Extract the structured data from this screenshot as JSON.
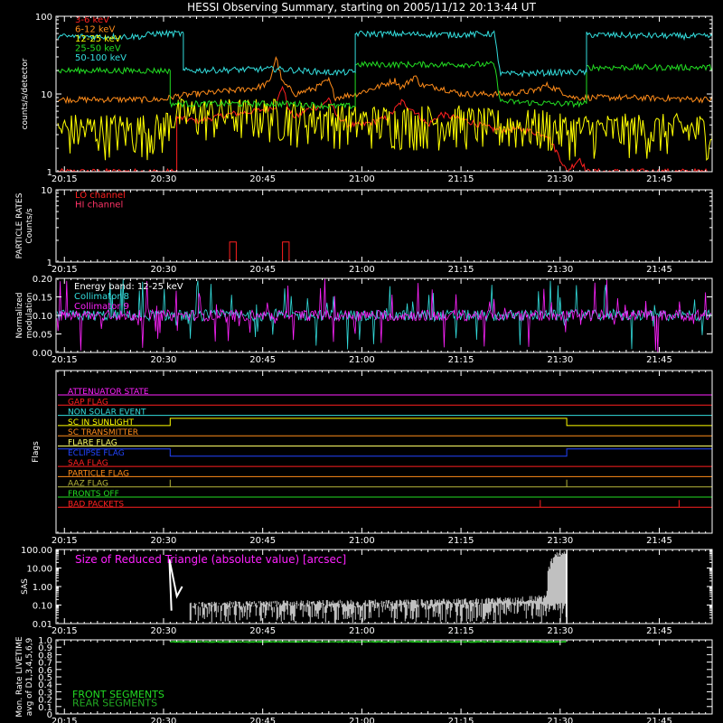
{
  "title": "HESSI Observing Summary, starting on 2005/11/12 20:13:44 UT",
  "time_axis": {
    "start": "20:13:44",
    "end": "21:53:00",
    "ticks": [
      "20:15",
      "20:30",
      "20:45",
      "21:00",
      "21:15",
      "21:30",
      "21:45"
    ]
  },
  "colors": {
    "red": "#ff2020",
    "orange": "#ff8c1a",
    "yellow": "#ffff00",
    "green": "#22dd22",
    "cyan": "#33dddd",
    "magenta": "#ff22ff",
    "blue": "#2244ff",
    "white": "#ffffff",
    "frame": "#ffffff"
  },
  "chart_data": [
    {
      "panel": "count-rates",
      "type": "line",
      "ylabel": "counts/s/detector",
      "yscale": "log",
      "ylim": [
        1,
        100
      ],
      "yticks": [
        "1",
        "10",
        "100"
      ],
      "series": [
        {
          "name": "3-6 keV",
          "color": "#ff2020",
          "points": [
            [
              "20:14",
              1.0
            ],
            [
              "20:32",
              1.0
            ],
            [
              "20:32",
              5.0
            ],
            [
              "20:35",
              4.5
            ],
            [
              "20:40",
              5.5
            ],
            [
              "20:44",
              6.0
            ],
            [
              "20:47",
              7.0
            ],
            [
              "20:48",
              13.0
            ],
            [
              "20:49",
              6.0
            ],
            [
              "20:50",
              5.0
            ],
            [
              "20:52",
              6.5
            ],
            [
              "20:54",
              7.0
            ],
            [
              "20:55",
              9.0
            ],
            [
              "20:56",
              5.5
            ],
            [
              "20:58",
              4.0
            ],
            [
              "21:00",
              4.0
            ],
            [
              "21:04",
              5.0
            ],
            [
              "21:06",
              8.0
            ],
            [
              "21:08",
              6.0
            ],
            [
              "21:10",
              4.0
            ],
            [
              "21:12",
              5.5
            ],
            [
              "21:16",
              4.5
            ],
            [
              "21:20",
              3.5
            ],
            [
              "21:24",
              3.5
            ],
            [
              "21:28",
              3.0
            ],
            [
              "21:30",
              1.5
            ],
            [
              "21:31",
              1.0
            ],
            [
              "21:33",
              1.5
            ],
            [
              "21:34",
              1.0
            ],
            [
              "21:53",
              1.0
            ]
          ]
        },
        {
          "name": "6-12 keV",
          "color": "#ff8c1a",
          "points": [
            [
              "20:14",
              8.5
            ],
            [
              "20:30",
              8.5
            ],
            [
              "20:32",
              9.5
            ],
            [
              "20:35",
              10.0
            ],
            [
              "20:40",
              11.0
            ],
            [
              "20:44",
              12.0
            ],
            [
              "20:46",
              14.0
            ],
            [
              "20:47",
              30.0
            ],
            [
              "20:48",
              14.0
            ],
            [
              "20:50",
              10.0
            ],
            [
              "20:53",
              12.0
            ],
            [
              "20:55",
              15.0
            ],
            [
              "20:56",
              9.0
            ],
            [
              "20:59",
              10.0
            ],
            [
              "21:02",
              12.0
            ],
            [
              "21:05",
              15.0
            ],
            [
              "21:06",
              12.0
            ],
            [
              "21:08",
              17.0
            ],
            [
              "21:09",
              13.0
            ],
            [
              "21:12",
              12.0
            ],
            [
              "21:15",
              10.0
            ],
            [
              "21:18",
              10.0
            ],
            [
              "21:22",
              10.0
            ],
            [
              "21:26",
              11.0
            ],
            [
              "21:28",
              13.0
            ],
            [
              "21:30",
              11.0
            ],
            [
              "21:32",
              9.0
            ],
            [
              "21:40",
              9.0
            ],
            [
              "21:53",
              8.5
            ]
          ]
        },
        {
          "name": "12-25 keV",
          "color": "#ffff00",
          "points": [
            [
              "20:14",
              3.5
            ],
            [
              "20:30",
              3.5
            ],
            [
              "20:31",
              5.5
            ],
            [
              "20:35",
              5.5
            ],
            [
              "20:44",
              5.5
            ],
            [
              "20:47",
              5.5
            ],
            [
              "20:50",
              5.0
            ],
            [
              "20:55",
              5.0
            ],
            [
              "20:59",
              4.5
            ],
            [
              "21:05",
              4.5
            ],
            [
              "21:10",
              4.5
            ],
            [
              "21:15",
              4.5
            ],
            [
              "21:20",
              4.0
            ],
            [
              "21:28",
              4.0
            ],
            [
              "21:30",
              3.5
            ],
            [
              "21:53",
              3.5
            ]
          ]
        },
        {
          "name": "25-50 keV",
          "color": "#22dd22",
          "points": [
            [
              "20:14",
              20.0
            ],
            [
              "20:31",
              20.0
            ],
            [
              "20:31",
              7.5
            ],
            [
              "20:40",
              7.5
            ],
            [
              "20:47",
              7.5
            ],
            [
              "20:50",
              7.5
            ],
            [
              "20:55",
              7.0
            ],
            [
              "20:59",
              7.0
            ],
            [
              "20:59",
              24.0
            ],
            [
              "21:15",
              24.0
            ],
            [
              "21:20",
              24.0
            ],
            [
              "21:21",
              8.0
            ],
            [
              "21:30",
              7.5
            ],
            [
              "21:34",
              7.5
            ],
            [
              "21:34",
              22.0
            ],
            [
              "21:53",
              22.0
            ]
          ]
        },
        {
          "name": "50-100 keV",
          "color": "#33dddd",
          "points": [
            [
              "20:14",
              55.0
            ],
            [
              "20:27",
              55.0
            ],
            [
              "20:28",
              60.0
            ],
            [
              "20:33",
              60.0
            ],
            [
              "20:33",
              20.0
            ],
            [
              "20:47",
              21.0
            ],
            [
              "20:55",
              19.0
            ],
            [
              "20:59",
              19.0
            ],
            [
              "20:59",
              60.0
            ],
            [
              "21:15",
              58.0
            ],
            [
              "21:20",
              60.0
            ],
            [
              "21:21",
              18.0
            ],
            [
              "21:30",
              19.0
            ],
            [
              "21:34",
              19.0
            ],
            [
              "21:34",
              58.0
            ],
            [
              "21:53",
              55.0
            ]
          ]
        }
      ]
    },
    {
      "panel": "particle-rates",
      "type": "line",
      "ylabel": "PARTICLE RATES\nCounts/s",
      "yscale": "log",
      "ylim": [
        1,
        10
      ],
      "yticks": [
        "1",
        "10"
      ],
      "series": [
        {
          "name": "LO channel",
          "color": "#ff2020",
          "points": [
            [
              "20:14",
              1.0
            ],
            [
              "20:40",
              1.0
            ],
            [
              "20:40",
              1.9
            ],
            [
              "20:41",
              1.9
            ],
            [
              "20:41",
              1.0
            ],
            [
              "20:48",
              1.0
            ],
            [
              "20:48",
              1.9
            ],
            [
              "20:49",
              1.9
            ],
            [
              "20:49",
              1.0
            ],
            [
              "21:53",
              1.0
            ]
          ]
        },
        {
          "name": "HI channel",
          "color": "#ff2020",
          "points": [
            [
              "20:14",
              1.0
            ],
            [
              "21:53",
              1.0
            ]
          ]
        }
      ]
    },
    {
      "panel": "modulation",
      "type": "line",
      "ylabel": "Normalized\nmodulation",
      "ylim": [
        0.0,
        0.2
      ],
      "yticks": [
        "0.00",
        "0.05",
        "0.10",
        "0.15",
        "0.20"
      ],
      "annotation": "Energy band: 12-25 keV",
      "series": [
        {
          "name": "Collimator 8",
          "color": "#33dddd",
          "baseline": 0.1
        },
        {
          "name": "Collimator 9",
          "color": "#ff22ff",
          "baseline": 0.1
        }
      ]
    },
    {
      "panel": "flags",
      "type": "line",
      "ylabel": "Flags",
      "series": [
        {
          "name": "ATTENUATOR STATE",
          "color": "#ff22ff",
          "segments": [
            [
              "20:14",
              0
            ],
            [
              "21:53",
              0
            ]
          ]
        },
        {
          "name": "GAP FLAG",
          "color": "#ff2020",
          "segments": [
            [
              "20:14",
              0
            ],
            [
              "21:53",
              0
            ]
          ]
        },
        {
          "name": "NON SOLAR EVENT",
          "color": "#33dddd",
          "segments": [
            [
              "20:14",
              0
            ],
            [
              "21:53",
              0
            ]
          ]
        },
        {
          "name": "SC IN SUNLIGHT",
          "color": "#ffff00",
          "segments": [
            [
              "20:14",
              0
            ],
            [
              "20:31",
              0
            ],
            [
              "20:31",
              1
            ],
            [
              "21:31",
              1
            ],
            [
              "21:31",
              0
            ],
            [
              "21:53",
              0
            ]
          ]
        },
        {
          "name": "SC TRANSMITTER",
          "color": "#ff8c1a",
          "segments": [
            [
              "20:14",
              0
            ],
            [
              "21:53",
              0
            ]
          ]
        },
        {
          "name": "FLARE FLAG",
          "color": "#ffff66",
          "segments": [
            [
              "20:14",
              0
            ],
            [
              "21:53",
              0
            ]
          ]
        },
        {
          "name": "ECLIPSE FLAG",
          "color": "#2244ff",
          "segments": [
            [
              "20:14",
              1
            ],
            [
              "20:31",
              1
            ],
            [
              "20:31",
              0
            ],
            [
              "21:31",
              0
            ],
            [
              "21:31",
              1
            ],
            [
              "21:53",
              1
            ]
          ]
        },
        {
          "name": "SAA FLAG",
          "color": "#ff2020",
          "segments": [
            [
              "20:14",
              0
            ],
            [
              "21:53",
              0
            ]
          ]
        },
        {
          "name": "PARTICLE FLAG",
          "color": "#ff8c1a",
          "segments": [
            [
              "20:14",
              0
            ],
            [
              "21:53",
              0
            ]
          ]
        },
        {
          "name": "AAZ FLAG",
          "color": "#b5b53a",
          "segments": [
            [
              "20:14",
              0
            ],
            [
              "20:31",
              0
            ],
            [
              "20:31",
              1
            ],
            [
              "20:31",
              0
            ],
            [
              "21:31",
              0
            ],
            [
              "21:31",
              1
            ],
            [
              "21:31",
              0
            ],
            [
              "21:53",
              0
            ]
          ]
        },
        {
          "name": "FRONTS OFF",
          "color": "#22dd22",
          "segments": [
            [
              "20:14",
              0
            ],
            [
              "21:53",
              0
            ]
          ]
        },
        {
          "name": "BAD PACKETS",
          "color": "#ff2020",
          "segments": [
            [
              "20:14",
              0
            ],
            [
              "21:27",
              0
            ],
            [
              "21:27",
              1
            ],
            [
              "21:27",
              0
            ],
            [
              "21:48",
              0
            ],
            [
              "21:48",
              1
            ],
            [
              "21:48",
              0
            ],
            [
              "21:53",
              0
            ]
          ]
        }
      ]
    },
    {
      "panel": "sas",
      "type": "line",
      "ylabel": "SAS",
      "yscale": "log",
      "ylim": [
        0.01,
        100.0
      ],
      "yticks": [
        "0.01",
        "0.10",
        "1.00",
        "10.00",
        "100.00"
      ],
      "annotation": "Size of Reduced Triangle (absolute value) [arcsec]",
      "series": [
        {
          "name": "Size of Reduced Triangle",
          "color": "#ffffff",
          "points": [
            [
              "20:31",
              0.05
            ],
            [
              "20:31",
              30.0
            ],
            [
              "20:32",
              0.3
            ],
            [
              "20:33",
              1.0
            ],
            [
              "20:34",
              0.1
            ],
            [
              "20:40",
              0.12
            ],
            [
              "20:50",
              0.13
            ],
            [
              "21:00",
              0.14
            ],
            [
              "21:10",
              0.15
            ],
            [
              "21:20",
              0.18
            ],
            [
              "21:28",
              0.25
            ],
            [
              "21:31",
              100.0
            ],
            [
              "21:31",
              0.01
            ]
          ]
        }
      ]
    },
    {
      "panel": "livetime",
      "type": "line",
      "ylabel": "Mon. Rate LIVETIME\navg of D1,3,4,5,6,9",
      "ylim": [
        0.0,
        1.0
      ],
      "yticks": [
        "0",
        "0.1",
        "0.2",
        "0.3",
        "0.4",
        "0.5",
        "0.6",
        "0.7",
        "0.8",
        "0.9",
        "1.0"
      ],
      "series": [
        {
          "name": "FRONT SEGMENTS",
          "color": "#22dd22",
          "points": [
            [
              "20:31",
              0.97
            ],
            [
              "21:00",
              0.96
            ],
            [
              "21:31",
              0.97
            ]
          ]
        },
        {
          "name": "REAR SEGMENTS",
          "color": "#22aa22",
          "points": [
            [
              "20:31",
              0.98
            ],
            [
              "21:31",
              0.98
            ]
          ]
        }
      ]
    }
  ]
}
